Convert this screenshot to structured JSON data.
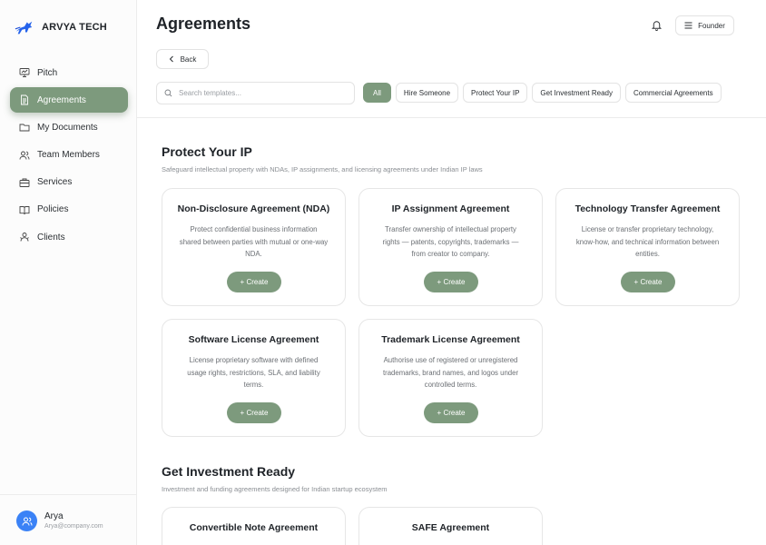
{
  "brand": {
    "name": "ARVYA TECH"
  },
  "sidebar": {
    "items": [
      {
        "label": "Pitch",
        "icon": "presentation-icon"
      },
      {
        "label": "Agreements",
        "icon": "document-icon",
        "active": true
      },
      {
        "label": "My Documents",
        "icon": "folder-icon"
      },
      {
        "label": "Team Members",
        "icon": "users-icon"
      },
      {
        "label": "Services",
        "icon": "briefcase-icon"
      },
      {
        "label": "Policies",
        "icon": "book-open-icon"
      },
      {
        "label": "Clients",
        "icon": "clients-icon"
      }
    ]
  },
  "user": {
    "name": "Arya",
    "email": "Arya@company.com"
  },
  "header": {
    "title": "Agreements",
    "founder_label": "Founder",
    "back_label": "Back"
  },
  "search": {
    "placeholder": "Search templates..."
  },
  "filters": [
    {
      "label": "All",
      "active": true
    },
    {
      "label": "Hire Someone"
    },
    {
      "label": "Protect Your IP"
    },
    {
      "label": "Get Investment Ready"
    },
    {
      "label": "Commercial Agreements"
    }
  ],
  "sections": [
    {
      "title": "Protect Your IP",
      "subtitle": "Safeguard intellectual property with NDAs, IP assignments, and licensing agreements under Indian IP laws",
      "cards": [
        {
          "title": "Non-Disclosure Agreement (NDA)",
          "desc": "Protect confidential business information shared between parties with mutual or one-way NDA.",
          "button": "+ Create"
        },
        {
          "title": "IP Assignment Agreement",
          "desc": "Transfer ownership of intellectual property rights — patents, copyrights, trademarks — from creator to company.",
          "button": "+ Create"
        },
        {
          "title": "Technology Transfer Agreement",
          "desc": "License or transfer proprietary technology, know-how, and technical information between entities.",
          "button": "+ Create"
        },
        {
          "title": "Software License Agreement",
          "desc": "License proprietary software with defined usage rights, restrictions, SLA, and liability terms.",
          "button": "+ Create"
        },
        {
          "title": "Trademark License Agreement",
          "desc": "Authorise use of registered or unregistered trademarks, brand names, and logos under controlled terms.",
          "button": "+ Create"
        }
      ]
    },
    {
      "title": "Get Investment Ready",
      "subtitle": "Investment and funding agreements designed for Indian startup ecosystem",
      "cards": [
        {
          "title": "Convertible Note Agreement"
        },
        {
          "title": "SAFE Agreement"
        }
      ]
    }
  ],
  "colors": {
    "accent": "#7d9a7d",
    "avatar": "#3b82f6"
  }
}
